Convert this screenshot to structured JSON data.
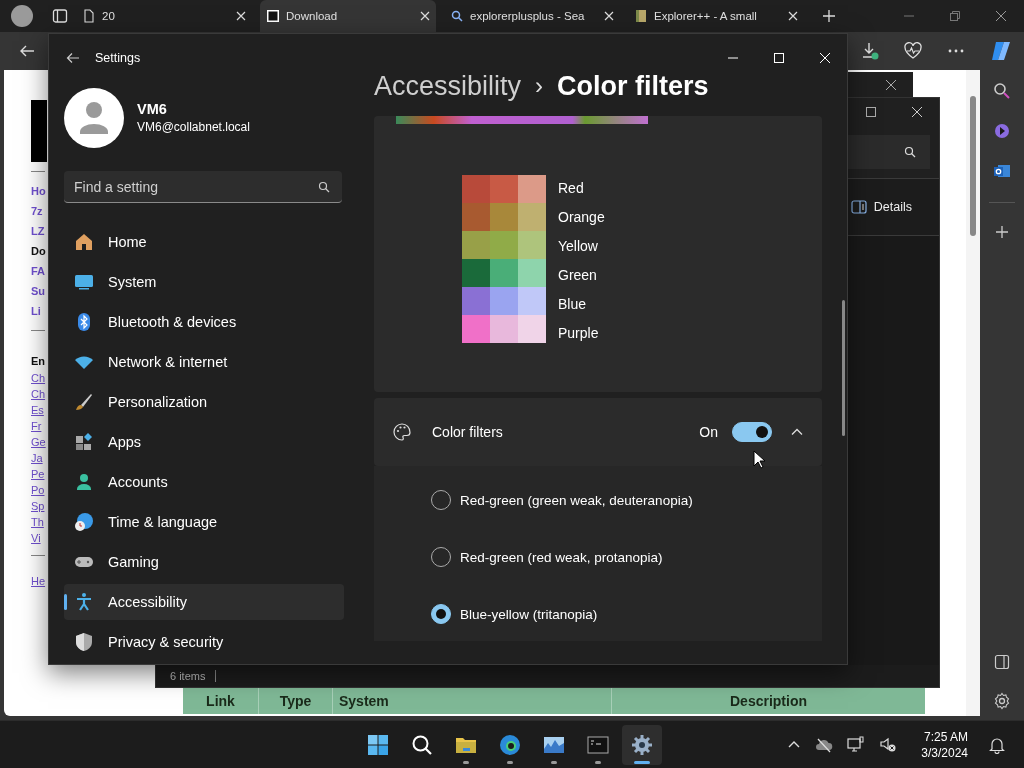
{
  "browser": {
    "tabs": [
      {
        "label": "20",
        "selected": false
      },
      {
        "label": "Download",
        "selected": true
      },
      {
        "label": "explorerplusplus - Sea",
        "selected": false
      },
      {
        "label": "Explorer++ - A small",
        "selected": false
      }
    ]
  },
  "page": {
    "links": [
      {
        "label": "Ho",
        "kind": "nav"
      },
      {
        "label": "7z",
        "kind": "nav"
      },
      {
        "label": "LZ",
        "kind": "nav"
      },
      {
        "label": "Do",
        "kind": "current"
      },
      {
        "label": "FA",
        "kind": "nav"
      },
      {
        "label": "Su",
        "kind": "nav"
      },
      {
        "label": "Li",
        "kind": "nav"
      },
      {
        "label": "En",
        "kind": "heading"
      },
      {
        "label": "Ch",
        "kind": "lang"
      },
      {
        "label": "Ch",
        "kind": "lang"
      },
      {
        "label": "Es",
        "kind": "lang"
      },
      {
        "label": "Fr",
        "kind": "lang"
      },
      {
        "label": "Ge",
        "kind": "lang"
      },
      {
        "label": "Ja",
        "kind": "lang"
      },
      {
        "label": "Pe",
        "kind": "lang"
      },
      {
        "label": "Po",
        "kind": "lang"
      },
      {
        "label": "Sp",
        "kind": "lang"
      },
      {
        "label": "Th",
        "kind": "lang"
      },
      {
        "label": "Vi",
        "kind": "lang"
      },
      {
        "label": "He",
        "kind": "footer"
      }
    ],
    "table": {
      "columns": [
        "Link",
        "Type",
        "System",
        "Description"
      ]
    }
  },
  "explorer": {
    "view_button": "Details",
    "status": "6 items"
  },
  "settings": {
    "title": "Settings",
    "user": {
      "name": "VM6",
      "email": "VM6@collabnet.local"
    },
    "search": {
      "placeholder": "Find a setting"
    },
    "nav": [
      {
        "label": "Home",
        "selected": false
      },
      {
        "label": "System",
        "selected": false
      },
      {
        "label": "Bluetooth & devices",
        "selected": false
      },
      {
        "label": "Network & internet",
        "selected": false
      },
      {
        "label": "Personalization",
        "selected": false
      },
      {
        "label": "Apps",
        "selected": false
      },
      {
        "label": "Accounts",
        "selected": false
      },
      {
        "label": "Time & language",
        "selected": false
      },
      {
        "label": "Gaming",
        "selected": false
      },
      {
        "label": "Accessibility",
        "selected": true
      },
      {
        "label": "Privacy & security",
        "selected": false
      }
    ],
    "breadcrumb": {
      "parent": "Accessibility",
      "separator": "›",
      "current": "Color filters"
    },
    "swatch_labels": [
      "Red",
      "Orange",
      "Yellow",
      "Green",
      "Blue",
      "Purple"
    ],
    "filter_toggle": {
      "label": "Color filters",
      "state_text": "On",
      "on": true,
      "expanded": true
    },
    "options": [
      {
        "label": "Red-green (green weak, deuteranopia)",
        "selected": false
      },
      {
        "label": "Red-green (red weak, protanopia)",
        "selected": false
      },
      {
        "label": "Blue-yellow (tritanopia)",
        "selected": true
      }
    ]
  },
  "taskbar": {
    "apps": [
      {
        "kind": "start",
        "running": false,
        "active": false
      },
      {
        "kind": "search",
        "running": false,
        "active": false
      },
      {
        "kind": "files",
        "running": true,
        "active": false
      },
      {
        "kind": "edge",
        "running": true,
        "active": false
      },
      {
        "kind": "monitor",
        "running": true,
        "active": false
      },
      {
        "kind": "terminal",
        "running": true,
        "active": false
      },
      {
        "kind": "settings",
        "running": true,
        "active": true
      }
    ],
    "time": "7:25 AM",
    "date": "3/3/2024"
  }
}
